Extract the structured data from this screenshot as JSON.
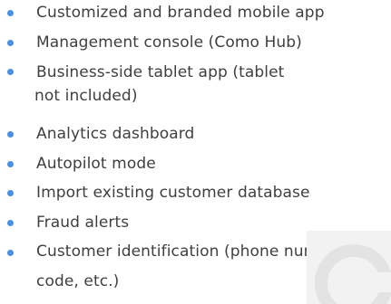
{
  "features": {
    "bullet_color": "#4a90e2",
    "items": [
      {
        "label": "Customized and branded mobile app"
      },
      {
        "label": "Management console (Como Hub)"
      },
      {
        "label": "Business-side tablet app (tablet not included)"
      },
      {
        "label": "Analytics dashboard"
      },
      {
        "label": "Autopilot mode"
      },
      {
        "label": "Import existing customer database"
      },
      {
        "label": "Fraud alerts"
      },
      {
        "label": "Customer identification (phone number, QR code, etc.)"
      }
    ]
  },
  "watermark": {
    "icon": "como-logo-watermark-icon"
  }
}
